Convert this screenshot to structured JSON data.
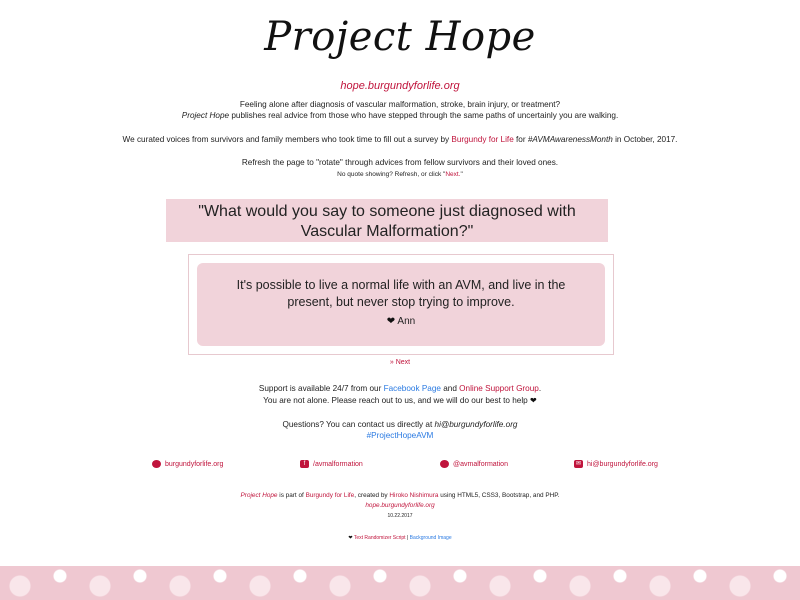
{
  "header": {
    "title": "Project Hope",
    "subtitle": "hope.burgundyforlife.org"
  },
  "intro": {
    "line1": "Feeling alone after diagnosis of vascular malformation, stroke, brain injury, or treatment?",
    "line2_em": "Project Hope",
    "line2_rest": " publishes real advice from those who have stepped through the same paths of uncertainly you are walking.",
    "line3_a": "We curated voices from survivors and family members who took time to fill out a survey by ",
    "line3_link": "Burgundy for Life",
    "line3_b": " for ",
    "line3_em": "#AVMAwarenessMonth",
    "line3_c": " in October, 2017.",
    "line4": "Refresh the page to \"rotate\" through advices from fellow survivors and their loved ones.",
    "line5_a": "No quote showing? Refresh, or click \"",
    "line5_link": "Next.",
    "line5_b": "\""
  },
  "question": "\"What would you say to someone just diagnosed with Vascular Malformation?\"",
  "quote": {
    "text": "It's possible to live a normal life with an AVM, and live in the present, but never stop trying to improve.",
    "heart": "❤",
    "author": "Ann"
  },
  "next_label": "» Next",
  "support": {
    "a": "Support is available 24/7 from our ",
    "fb": "Facebook Page",
    "b": " and ",
    "group": "Online Support Group",
    "c": ".",
    "line2": "You are not alone. Please reach out to us, and we will do our best to help ",
    "heart": "❤"
  },
  "contact": {
    "a": "Questions? You can contact us directly at ",
    "email": "hi@burgundyforlife.org",
    "hashtag": "#ProjectHopeAVM"
  },
  "social": [
    {
      "icon": "globe-icon",
      "label": "burgundyforlife.org"
    },
    {
      "icon": "facebook-icon",
      "label": "/avmalformation"
    },
    {
      "icon": "twitter-icon",
      "label": "@avmalformation"
    },
    {
      "icon": "mail-icon",
      "label": "hi@burgundyforlife.org"
    }
  ],
  "footer": {
    "em": "Project Hope",
    "a": " is part of ",
    "bfl": "Burgundy for Life",
    "b": ", created by ",
    "author": "Hiroko Nishimura",
    "c": " using HTML5, CSS3, Bootstrap, and PHP.",
    "site": "hope.burgundyforlife.org",
    "date": "10.22.2017",
    "credits_heart": "❤",
    "credit1": "Text Randomizer Script",
    "sep": " | ",
    "credit2": "Background Image"
  },
  "colors": {
    "accent": "#c0143c",
    "link_blue": "#2a7ae2",
    "pink_box": "#f1d3da"
  }
}
